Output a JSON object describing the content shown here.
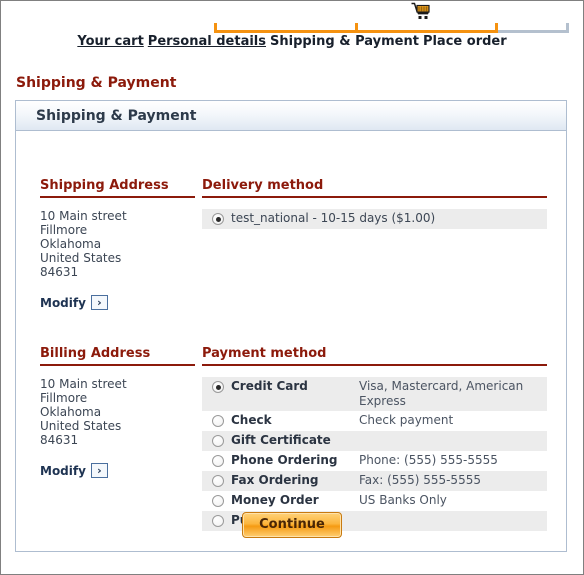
{
  "checkout": {
    "cart_icon": "shopping-cart-icon",
    "steps": [
      {
        "label": "Your cart",
        "state": "done"
      },
      {
        "label": "Personal details",
        "state": "done"
      },
      {
        "label": "Shipping & Payment",
        "state": "current"
      },
      {
        "label": "Place order",
        "state": "todo"
      }
    ],
    "progress": {
      "done_color": "#f59210",
      "todo_color": "#b4c0ce"
    }
  },
  "page_title": "Shipping & Payment",
  "panel": {
    "header_title": "Shipping & Payment"
  },
  "shipping": {
    "section_title": "Shipping Address",
    "address": [
      "10 Main street",
      "Fillmore",
      "Oklahoma",
      "United States",
      "84631"
    ],
    "modify_label": "Modify",
    "modify_arrow": "chevron-right-icon"
  },
  "billing": {
    "section_title": "Billing Address",
    "address": [
      "10 Main street",
      "Fillmore",
      "Oklahoma",
      "United States",
      "84631"
    ],
    "modify_label": "Modify",
    "modify_arrow": "chevron-right-icon"
  },
  "delivery": {
    "section_title": "Delivery method",
    "options": [
      {
        "label": "test_national - 10-15 days ($1.00)",
        "selected": true
      }
    ]
  },
  "payment": {
    "section_title": "Payment method",
    "options": [
      {
        "name": "Credit Card",
        "desc": "Visa, Mastercard, American Express",
        "selected": true
      },
      {
        "name": "Check",
        "desc": "Check payment",
        "selected": false
      },
      {
        "name": "Gift Certificate",
        "desc": "",
        "selected": false
      },
      {
        "name": "Phone Ordering",
        "desc": "Phone: (555) 555-5555",
        "selected": false
      },
      {
        "name": "Fax Ordering",
        "desc": "Fax: (555) 555-5555",
        "selected": false
      },
      {
        "name": "Money Order",
        "desc": "US Banks Only",
        "selected": false
      },
      {
        "name": "Purchase Order",
        "desc": "",
        "selected": false
      }
    ]
  },
  "actions": {
    "continue_label": "Continue"
  },
  "colors": {
    "accent_red": "#8c1a0b",
    "orange": "#f59210",
    "panel_border": "#aebdd0",
    "row_shade": "#ececec"
  }
}
